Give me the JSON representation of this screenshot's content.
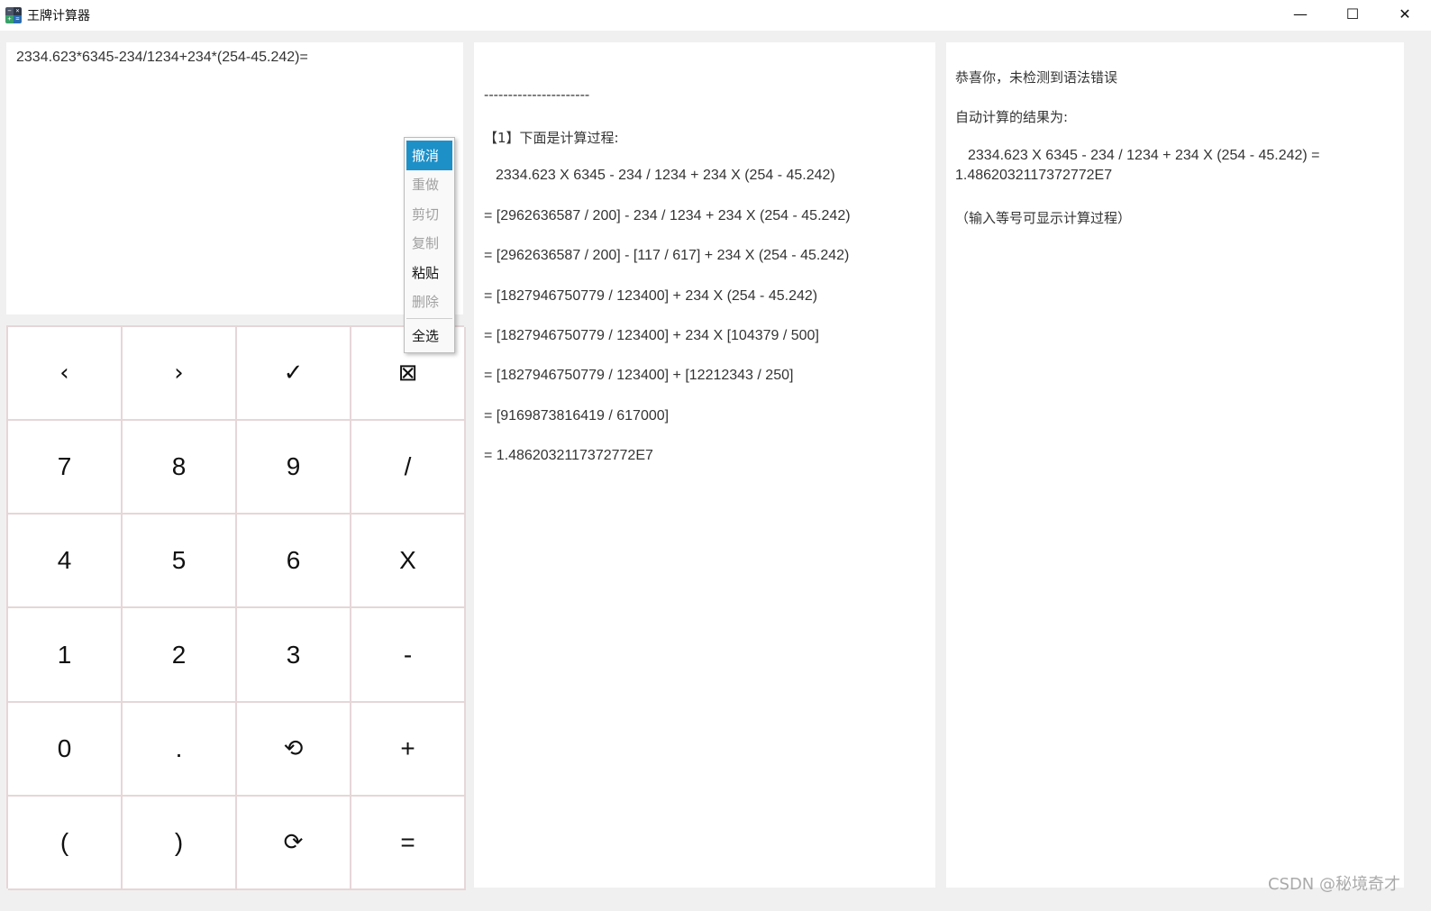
{
  "window": {
    "title": "王牌计算器",
    "controls": [
      "—",
      "☐",
      "✕"
    ]
  },
  "input": {
    "expression": "2334.623*6345-234/1234+234*(254-45.242)="
  },
  "context_menu": {
    "items": [
      {
        "label": "撤消",
        "state": "active"
      },
      {
        "label": "重做",
        "state": "disabled"
      },
      {
        "label": "剪切",
        "state": "disabled"
      },
      {
        "label": "复制",
        "state": "disabled"
      },
      {
        "label": "粘贴",
        "state": "enabled"
      },
      {
        "label": "删除",
        "state": "disabled"
      }
    ],
    "select_all": "全选"
  },
  "keypad": {
    "keys": [
      {
        "label": "‹",
        "name": "key-left-arrow"
      },
      {
        "label": "›",
        "name": "key-right-arrow"
      },
      {
        "label": "✓",
        "name": "key-check"
      },
      {
        "label": "⊠",
        "name": "key-clear"
      },
      {
        "label": "7",
        "name": "key-7"
      },
      {
        "label": "8",
        "name": "key-8"
      },
      {
        "label": "9",
        "name": "key-9"
      },
      {
        "label": "/",
        "name": "key-divide"
      },
      {
        "label": "4",
        "name": "key-4"
      },
      {
        "label": "5",
        "name": "key-5"
      },
      {
        "label": "6",
        "name": "key-6"
      },
      {
        "label": "X",
        "name": "key-multiply"
      },
      {
        "label": "1",
        "name": "key-1"
      },
      {
        "label": "2",
        "name": "key-2"
      },
      {
        "label": "3",
        "name": "key-3"
      },
      {
        "label": "-",
        "name": "key-minus"
      },
      {
        "label": "0",
        "name": "key-0"
      },
      {
        "label": ".",
        "name": "key-decimal"
      },
      {
        "label": "⟲",
        "name": "key-undo"
      },
      {
        "label": "+",
        "name": "key-plus"
      },
      {
        "label": "(",
        "name": "key-open-paren"
      },
      {
        "label": ")",
        "name": "key-close-paren"
      },
      {
        "label": "⟳",
        "name": "key-redo"
      },
      {
        "label": "=",
        "name": "key-equals"
      }
    ]
  },
  "process": {
    "separator": "----------------------",
    "header": "【1】下面是计算过程:",
    "steps": [
      "2334.623 X 6345 - 234 / 1234 + 234 X (254 - 45.242)",
      "= [2962636587 / 200] - 234 / 1234 + 234 X (254 - 45.242)",
      "= [2962636587 / 200] - [117 / 617] + 234 X (254 - 45.242)",
      "= [1827946750779 / 123400] + 234 X (254 - 45.242)",
      "= [1827946750779 / 123400] + 234 X [104379 / 500]",
      "= [1827946750779 / 123400] + [12212343 / 250]",
      "= [9169873816419 / 617000]",
      "= 1.4862032117372772E7"
    ]
  },
  "result": {
    "status": "恭喜你，未检测到语法错误",
    "label": "自动计算的结果为:",
    "expression": "2334.623 X 6345 - 234 / 1234 + 234 X (254 - 45.242) =",
    "value": "1.4862032117372772E7",
    "hint": "（输入等号可显示计算过程）"
  },
  "watermark": "CSDN @秘境奇才"
}
